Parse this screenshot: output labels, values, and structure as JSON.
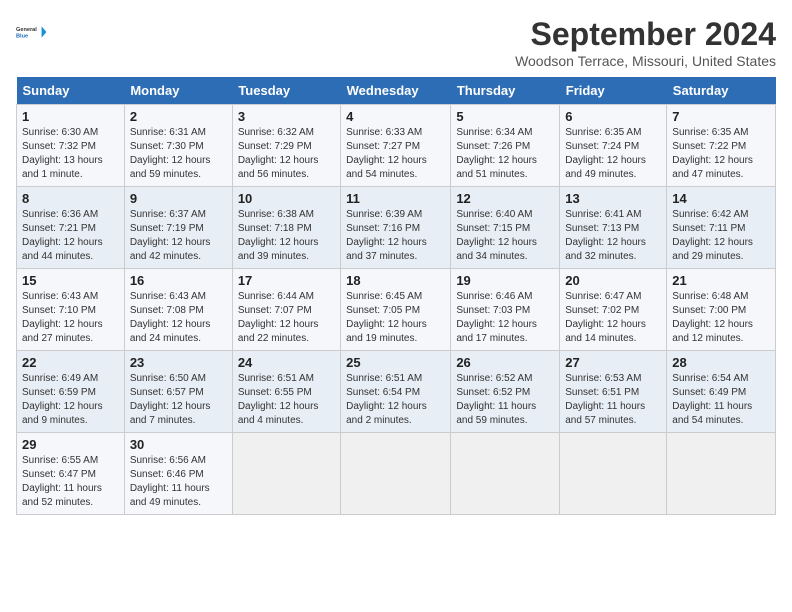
{
  "header": {
    "logo_line1": "General",
    "logo_line2": "Blue",
    "month": "September 2024",
    "location": "Woodson Terrace, Missouri, United States"
  },
  "weekdays": [
    "Sunday",
    "Monday",
    "Tuesday",
    "Wednesday",
    "Thursday",
    "Friday",
    "Saturday"
  ],
  "weeks": [
    [
      {
        "day": "1",
        "info": "Sunrise: 6:30 AM\nSunset: 7:32 PM\nDaylight: 13 hours\nand 1 minute."
      },
      {
        "day": "2",
        "info": "Sunrise: 6:31 AM\nSunset: 7:30 PM\nDaylight: 12 hours\nand 59 minutes."
      },
      {
        "day": "3",
        "info": "Sunrise: 6:32 AM\nSunset: 7:29 PM\nDaylight: 12 hours\nand 56 minutes."
      },
      {
        "day": "4",
        "info": "Sunrise: 6:33 AM\nSunset: 7:27 PM\nDaylight: 12 hours\nand 54 minutes."
      },
      {
        "day": "5",
        "info": "Sunrise: 6:34 AM\nSunset: 7:26 PM\nDaylight: 12 hours\nand 51 minutes."
      },
      {
        "day": "6",
        "info": "Sunrise: 6:35 AM\nSunset: 7:24 PM\nDaylight: 12 hours\nand 49 minutes."
      },
      {
        "day": "7",
        "info": "Sunrise: 6:35 AM\nSunset: 7:22 PM\nDaylight: 12 hours\nand 47 minutes."
      }
    ],
    [
      {
        "day": "8",
        "info": "Sunrise: 6:36 AM\nSunset: 7:21 PM\nDaylight: 12 hours\nand 44 minutes."
      },
      {
        "day": "9",
        "info": "Sunrise: 6:37 AM\nSunset: 7:19 PM\nDaylight: 12 hours\nand 42 minutes."
      },
      {
        "day": "10",
        "info": "Sunrise: 6:38 AM\nSunset: 7:18 PM\nDaylight: 12 hours\nand 39 minutes."
      },
      {
        "day": "11",
        "info": "Sunrise: 6:39 AM\nSunset: 7:16 PM\nDaylight: 12 hours\nand 37 minutes."
      },
      {
        "day": "12",
        "info": "Sunrise: 6:40 AM\nSunset: 7:15 PM\nDaylight: 12 hours\nand 34 minutes."
      },
      {
        "day": "13",
        "info": "Sunrise: 6:41 AM\nSunset: 7:13 PM\nDaylight: 12 hours\nand 32 minutes."
      },
      {
        "day": "14",
        "info": "Sunrise: 6:42 AM\nSunset: 7:11 PM\nDaylight: 12 hours\nand 29 minutes."
      }
    ],
    [
      {
        "day": "15",
        "info": "Sunrise: 6:43 AM\nSunset: 7:10 PM\nDaylight: 12 hours\nand 27 minutes."
      },
      {
        "day": "16",
        "info": "Sunrise: 6:43 AM\nSunset: 7:08 PM\nDaylight: 12 hours\nand 24 minutes."
      },
      {
        "day": "17",
        "info": "Sunrise: 6:44 AM\nSunset: 7:07 PM\nDaylight: 12 hours\nand 22 minutes."
      },
      {
        "day": "18",
        "info": "Sunrise: 6:45 AM\nSunset: 7:05 PM\nDaylight: 12 hours\nand 19 minutes."
      },
      {
        "day": "19",
        "info": "Sunrise: 6:46 AM\nSunset: 7:03 PM\nDaylight: 12 hours\nand 17 minutes."
      },
      {
        "day": "20",
        "info": "Sunrise: 6:47 AM\nSunset: 7:02 PM\nDaylight: 12 hours\nand 14 minutes."
      },
      {
        "day": "21",
        "info": "Sunrise: 6:48 AM\nSunset: 7:00 PM\nDaylight: 12 hours\nand 12 minutes."
      }
    ],
    [
      {
        "day": "22",
        "info": "Sunrise: 6:49 AM\nSunset: 6:59 PM\nDaylight: 12 hours\nand 9 minutes."
      },
      {
        "day": "23",
        "info": "Sunrise: 6:50 AM\nSunset: 6:57 PM\nDaylight: 12 hours\nand 7 minutes."
      },
      {
        "day": "24",
        "info": "Sunrise: 6:51 AM\nSunset: 6:55 PM\nDaylight: 12 hours\nand 4 minutes."
      },
      {
        "day": "25",
        "info": "Sunrise: 6:51 AM\nSunset: 6:54 PM\nDaylight: 12 hours\nand 2 minutes."
      },
      {
        "day": "26",
        "info": "Sunrise: 6:52 AM\nSunset: 6:52 PM\nDaylight: 11 hours\nand 59 minutes."
      },
      {
        "day": "27",
        "info": "Sunrise: 6:53 AM\nSunset: 6:51 PM\nDaylight: 11 hours\nand 57 minutes."
      },
      {
        "day": "28",
        "info": "Sunrise: 6:54 AM\nSunset: 6:49 PM\nDaylight: 11 hours\nand 54 minutes."
      }
    ],
    [
      {
        "day": "29",
        "info": "Sunrise: 6:55 AM\nSunset: 6:47 PM\nDaylight: 11 hours\nand 52 minutes."
      },
      {
        "day": "30",
        "info": "Sunrise: 6:56 AM\nSunset: 6:46 PM\nDaylight: 11 hours\nand 49 minutes."
      },
      {
        "day": "",
        "info": ""
      },
      {
        "day": "",
        "info": ""
      },
      {
        "day": "",
        "info": ""
      },
      {
        "day": "",
        "info": ""
      },
      {
        "day": "",
        "info": ""
      }
    ]
  ]
}
